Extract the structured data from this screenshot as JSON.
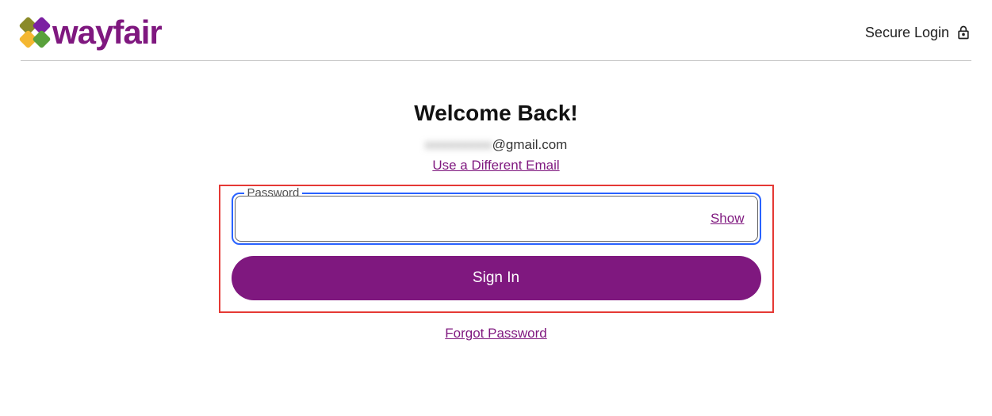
{
  "header": {
    "brand": "wayfair",
    "secure_label": "Secure Login"
  },
  "main": {
    "title": "Welcome Back!",
    "email_obscured": "xxxxxxxxxx",
    "email_domain": "@gmail.com",
    "different_email_link": "Use a Different Email",
    "password_label": "Password",
    "password_value": "",
    "show_label": "Show",
    "signin_label": "Sign In",
    "forgot_label": "Forgot Password"
  }
}
